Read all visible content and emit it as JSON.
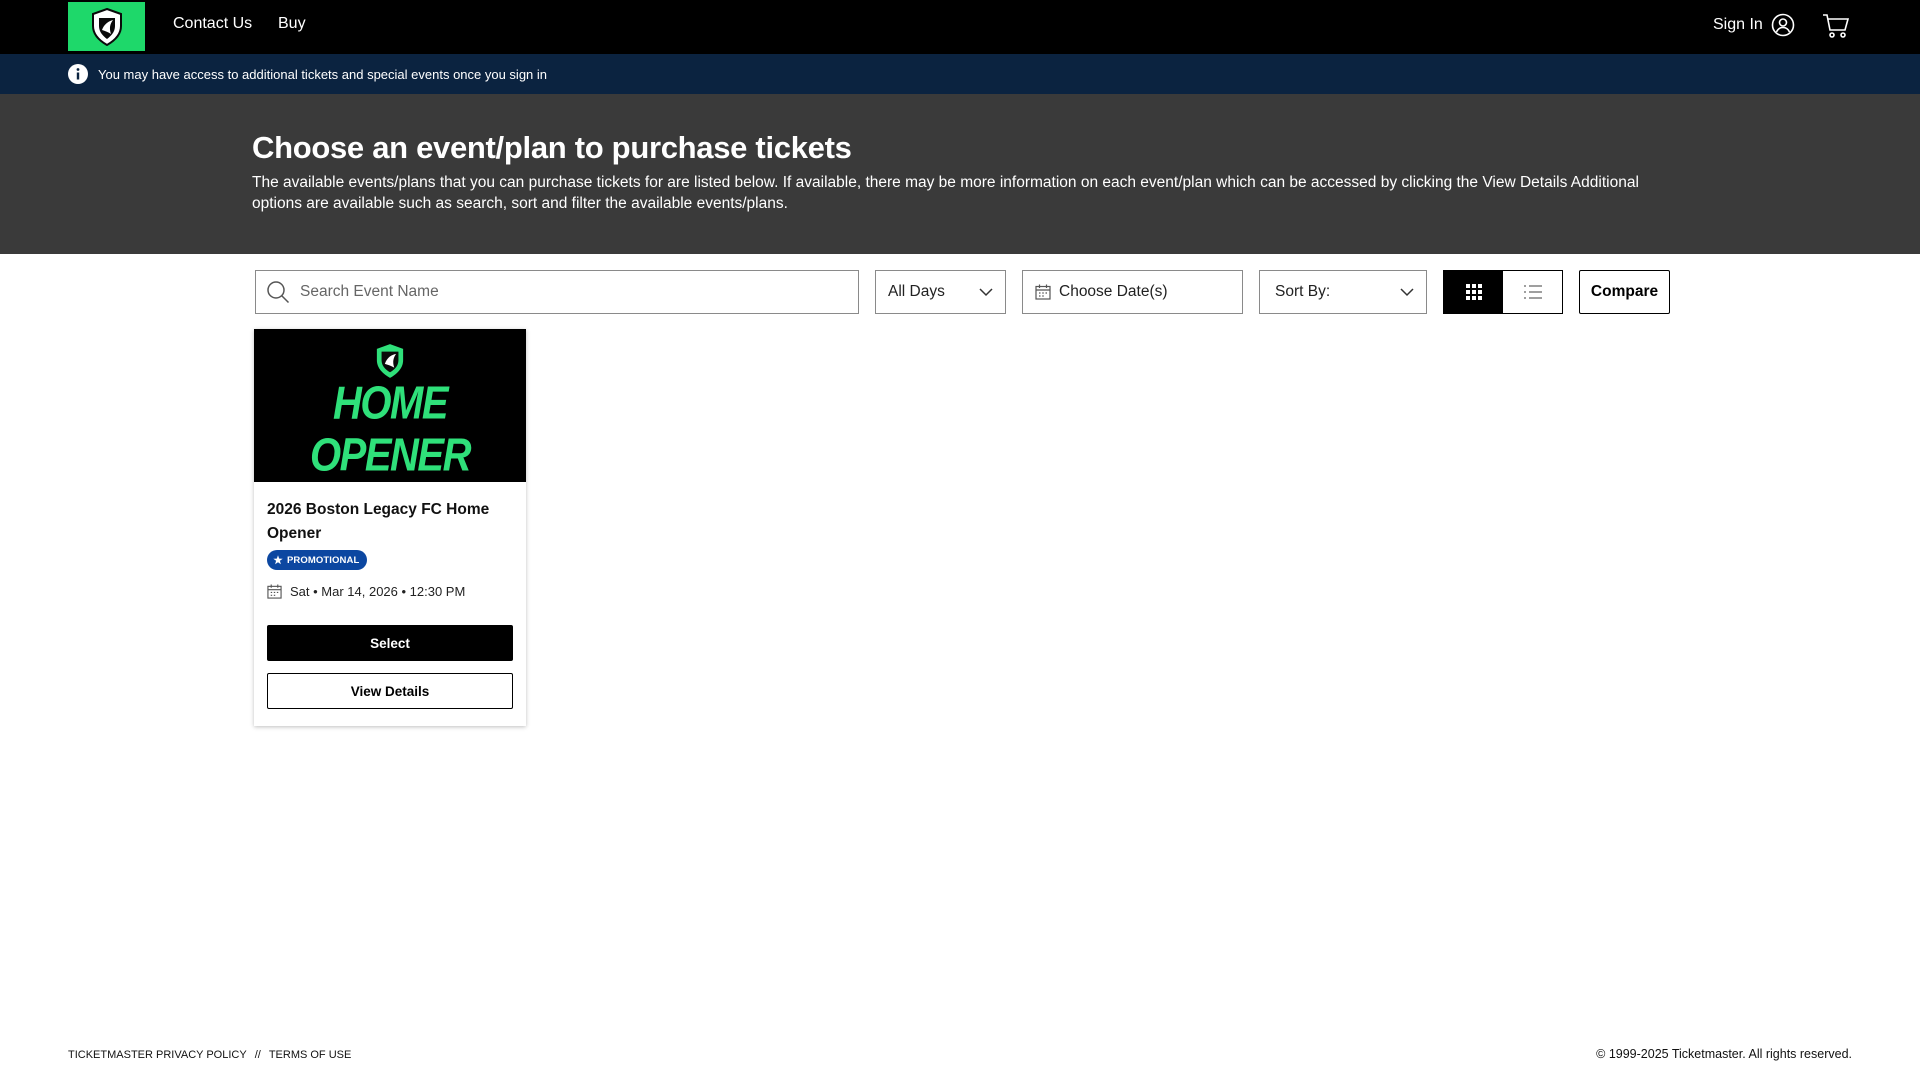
{
  "nav": {
    "contact": "Contact Us",
    "buy": "Buy",
    "signin": "Sign In"
  },
  "info": {
    "message": "You may have access to additional tickets and special events once you sign in"
  },
  "hero": {
    "title": "Choose an event/plan to purchase tickets",
    "description": "The available events/plans that you can purchase tickets for are listed below. If available, there may be more information on each event/plan which can be accessed by clicking the View Details Additional options are available such as search, sort and filter the available events/plans."
  },
  "toolbar": {
    "search_placeholder": "Search Event Name",
    "days": "All Days",
    "dates": "Choose Date(s)",
    "sort": "Sort By:",
    "compare": "Compare"
  },
  "event": {
    "image_text": "HOME OPENER",
    "title": "2026 Boston Legacy FC Home Opener",
    "badge": "PROMOTIONAL",
    "date": "Sat • Mar 14, 2026 • 12:30 PM",
    "select": "Select",
    "details": "View Details"
  },
  "footer": {
    "privacy": "TICKETMASTER PRIVACY POLICY",
    "separator": "//",
    "terms": "TERMS OF USE",
    "copyright": "© 1999-2025 Ticketmaster. All rights reserved."
  },
  "colors": {
    "brand_green": "#1ed86a",
    "info_bar": "#0b2340",
    "hero_bg": "#3a3a3a",
    "badge_blue": "#0c47a1"
  }
}
